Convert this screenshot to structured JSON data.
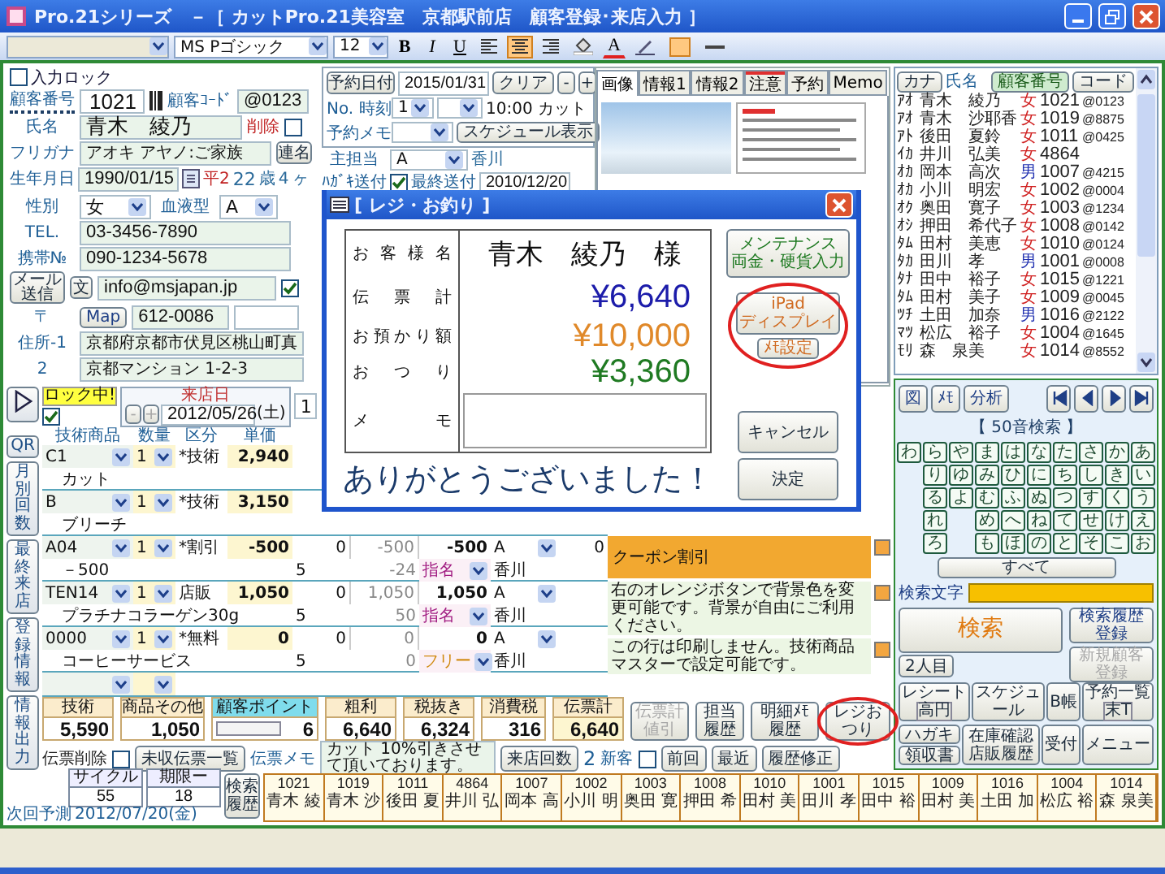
{
  "window": {
    "title": "Pro.21シリーズ　－［ カットPro.21美容室　京都駅前店　顧客登録･来店入力 ］"
  },
  "toolbar": {
    "font": "MS Pゴシック",
    "size": "12",
    "format_buttons": [
      "B",
      "I",
      "U"
    ],
    "align": [
      {
        "selected": false
      },
      {
        "selected": true
      },
      {
        "selected": false
      }
    ],
    "font_color_label": "A"
  },
  "customer": {
    "input_lock": {
      "label": "入力ロック",
      "checked": false
    },
    "number_label": "顧客番号",
    "number": "1021",
    "code_label": "顧客ｺｰﾄﾞ",
    "code": "@0123",
    "name_label": "氏名",
    "name": "青木　綾乃",
    "delete_label": "削除",
    "delete_checked": false,
    "kana_label": "フリガナ",
    "kana": "アオキ アヤノ:ご家族",
    "joint_button": "連名",
    "birth_label": "生年月日",
    "birth": "1990/01/15",
    "era": "平2",
    "age": "22",
    "age_unit": "歳",
    "months": "4",
    "months_unit": "ヶ",
    "sex_label": "性別",
    "sex": "女",
    "blood_label": "血液型",
    "blood": "A",
    "tel_label": "TEL.",
    "tel": "03-3456-7890",
    "mobile_label": "携帯№",
    "mobile": "090-1234-5678",
    "mail_button": "メール送信",
    "text_button": "文",
    "email": "info@msjapan.jp",
    "mail_checked": true,
    "zip_label": "〒",
    "map_button": "Map",
    "zip": "612-0086",
    "address1_label": "住所-1",
    "address1": "京都府京都市伏見区桃山町真",
    "address2_label": "2",
    "address2": "京都マンション 1-2-3"
  },
  "reservation": {
    "date_button": "予約日付",
    "date": "2015/01/31",
    "clear_button": "クリア",
    "step_buttons": [
      "-",
      "+"
    ],
    "no_label": "No. 時刻",
    "no": "1",
    "memo_label": "予約メモ",
    "memo": "10:00 カット",
    "schedule_button": "スケジュール表示",
    "staff_label": "主担当",
    "staff": "A",
    "staff_name": "香川",
    "postcard_label": "ﾊｶﾞｷ送付",
    "postcard_checked": true,
    "last_sent_label": "最終送付",
    "last_sent": "2010/12/20"
  },
  "tabs": [
    {
      "label": "画像",
      "selected": true,
      "alert": false
    },
    {
      "label": "情報1",
      "selected": false,
      "alert": false
    },
    {
      "label": "情報2",
      "selected": false,
      "alert": false
    },
    {
      "label": "注意",
      "selected": false,
      "alert": true
    },
    {
      "label": "予約",
      "selected": false,
      "alert": false
    },
    {
      "label": "Memo",
      "selected": false,
      "alert": false
    }
  ],
  "customer_list": {
    "kana_button": "カナ",
    "name_header": "氏名",
    "number_button": "顧客番号",
    "code_button": "コード",
    "rows": [
      {
        "kana": "ｱｵ",
        "name": "青木　綾乃",
        "sex": "女",
        "kind": "female",
        "number": "1021",
        "code": "@0123"
      },
      {
        "kana": "ｱｵ",
        "name": "青木　沙耶香",
        "sex": "女",
        "kind": "female",
        "number": "1019",
        "code": "@8875"
      },
      {
        "kana": "ｱﾄ",
        "name": "後田　夏鈴",
        "sex": "女",
        "kind": "female",
        "number": "1011",
        "code": "@0425"
      },
      {
        "kana": "ｲｶ",
        "name": "井川　弘美",
        "sex": "女",
        "kind": "female",
        "number": "4864"
      },
      {
        "kana": "ｵｶ",
        "name": "岡本　高次",
        "sex": "男",
        "kind": "male",
        "number": "1007",
        "code": "@4215"
      },
      {
        "kana": "ｵｶ",
        "name": "小川　明宏",
        "sex": "女",
        "kind": "female",
        "number": "1002",
        "code": "@0004"
      },
      {
        "kana": "ｵｸ",
        "name": "奥田　寛子",
        "sex": "女",
        "kind": "female",
        "number": "1003",
        "code": "@1234"
      },
      {
        "kana": "ｵｼ",
        "name": "押田　希代子",
        "sex": "女",
        "kind": "female",
        "number": "1008",
        "code": "@0142"
      },
      {
        "kana": "ﾀﾑ",
        "name": "田村　美恵",
        "sex": "女",
        "kind": "female",
        "number": "1010",
        "code": "@0124"
      },
      {
        "kana": "ﾀｶ",
        "name": "田川　孝",
        "sex": "男",
        "kind": "male",
        "number": "1001",
        "code": "@0008"
      },
      {
        "kana": "ﾀﾅ",
        "name": "田中　裕子",
        "sex": "女",
        "kind": "female",
        "number": "1015",
        "code": "@1221"
      },
      {
        "kana": "ﾀﾑ",
        "name": "田村　美子",
        "sex": "女",
        "kind": "female",
        "number": "1009",
        "code": "@0045"
      },
      {
        "kana": "ﾂﾁ",
        "name": "土田　加奈",
        "sex": "男",
        "kind": "male",
        "number": "1016",
        "code": "@2122"
      },
      {
        "kana": "ﾏﾂ",
        "name": "松広　裕子",
        "sex": "女",
        "kind": "female",
        "number": "1004",
        "code": "@1645"
      },
      {
        "kana": "ﾓﾘ",
        "name": "森　泉美",
        "sex": "女",
        "kind": "female",
        "number": "1014",
        "code": "@8552"
      }
    ]
  },
  "side_buttons": [
    "QR",
    "月別回数",
    "最終来店",
    "登録情報",
    "情報出力"
  ],
  "visit": {
    "lock_label": "ロック中!",
    "lock_checked": true,
    "date_label": "来店日",
    "step_buttons": [
      "-",
      "+"
    ],
    "date": "2012/05/26",
    "weekday": "(土)",
    "count": "1"
  },
  "items": {
    "columns": [
      "技術商品",
      "数量",
      "区分",
      "単価"
    ],
    "rows": [
      {
        "kind": "item",
        "code": "C1",
        "qty": "1",
        "category": "*技術",
        "price": "2,940",
        "name": "カット"
      },
      {
        "kind": "item",
        "code": "B",
        "qty": "1",
        "category": "*技術",
        "price": "3,150",
        "name": "ブリーチ"
      },
      {
        "kind": "item",
        "code": "A04",
        "qty": "1",
        "category": "*割引",
        "price": "-500",
        "column_5": "0",
        "column_6": "-500",
        "column_7": "-500",
        "column_8": "A",
        "column_9": "0",
        "name": "－500",
        "sub_5": "5",
        "sub_6": "-24",
        "nomination": {
          "label": "指名",
          "color": "#a01a80"
        },
        "staff": "香川"
      },
      {
        "kind": "item",
        "code": "TEN14",
        "qty": "1",
        "category": "店販",
        "price": "1,050",
        "column_5": "0",
        "column_6": "1,050",
        "column_7": "1,050",
        "column_8": "A",
        "name": "プラチナコラーゲン30g",
        "sub_5": "5",
        "sub_6": "50",
        "nomination": {
          "label": "指名",
          "color": "#a01a80"
        },
        "staff": "香川"
      },
      {
        "kind": "item",
        "code": "0000",
        "qty": "1",
        "category": "*無料",
        "price": "0",
        "column_5": "0",
        "column_6": "0",
        "column_7": "0",
        "column_8": "A",
        "name": "コーヒーサービス",
        "sub_5": "5",
        "sub_6": "0",
        "nomination": {
          "label": "フリー",
          "color": "#d08a10"
        },
        "staff": "香川"
      },
      {
        "kind": "blank"
      }
    ]
  },
  "notes": [
    {
      "kind": "tag",
      "text": "クーポン割引"
    },
    {
      "kind": "text",
      "text": "右のオレンジボタンで背景色を変更可能です。背景が自由にご利用ください。"
    },
    {
      "kind": "text",
      "text": "この行は印刷しません。技術商品マスターで設定可能です。"
    }
  ],
  "totals": [
    {
      "label": "技術",
      "value": "5,590",
      "kind": "plain"
    },
    {
      "label": "商品その他",
      "value": "1,050",
      "kind": "plain"
    },
    {
      "label": "顧客ポイント",
      "value": "6",
      "kind": "points"
    },
    {
      "label": "粗利",
      "value": "6,640",
      "kind": "plain"
    },
    {
      "label": "税抜き",
      "value": "6,324",
      "kind": "plain"
    },
    {
      "label": "消費税",
      "value": "316",
      "kind": "plain"
    },
    {
      "label": "伝票計",
      "value": "6,640",
      "kind": "plain"
    }
  ],
  "total_buttons": [
    {
      "label": "伝票計値引",
      "disabled": true,
      "circled": false
    },
    {
      "label": "担当履歴",
      "disabled": false,
      "circled": false
    },
    {
      "label": "明細ﾒﾓ履歴",
      "disabled": false,
      "circled": false
    },
    {
      "label": "レジおつり",
      "disabled": false,
      "circled": true
    }
  ],
  "slip": {
    "delete_label": "伝票削除",
    "delete_checked": false,
    "unpaid_button": "未収伝票一覧",
    "memo_label": "伝票メモ",
    "memo": "カット 10%引きさせて頂いております。",
    "visits_button": "来店回数",
    "visits": "2",
    "new_label": "新客",
    "new_checked": false,
    "buttons": [
      "前回",
      "最近",
      "履歴修正"
    ]
  },
  "forecast": {
    "label": "次回予測",
    "date": "2012/07/20(金)",
    "cycle_label": "サイクル",
    "cycle": "55",
    "limit_label": "期限ー",
    "limit": "18",
    "history_button": "検索履歴"
  },
  "recent": [
    {
      "number": "1021",
      "name": "青木 綾"
    },
    {
      "number": "1019",
      "name": "青木 沙"
    },
    {
      "number": "1011",
      "name": "後田 夏"
    },
    {
      "number": "4864",
      "name": "井川 弘"
    },
    {
      "number": "1007",
      "name": "岡本 高"
    },
    {
      "number": "1002",
      "name": "小川 明"
    },
    {
      "number": "1003",
      "name": "奥田 寛"
    },
    {
      "number": "1008",
      "name": "押田 希"
    },
    {
      "number": "1010",
      "name": "田村 美"
    },
    {
      "number": "1001",
      "name": "田川 孝"
    },
    {
      "number": "1015",
      "name": "田中 裕"
    },
    {
      "number": "1009",
      "name": "田村 美"
    },
    {
      "number": "1016",
      "name": "土田 加"
    },
    {
      "number": "1004",
      "name": "松広 裕"
    },
    {
      "number": "1014",
      "name": "森 泉美"
    }
  ],
  "search": {
    "tool_buttons": [
      "図",
      "ﾒﾓ",
      "分析"
    ],
    "title": "【 50音検索 】",
    "kana_rows": [
      [
        "わ",
        "ら",
        "や",
        "ま",
        "は",
        "な",
        "た",
        "さ",
        "か",
        "あ"
      ],
      [
        null,
        "り",
        "ゆ",
        "み",
        "ひ",
        "に",
        "ち",
        "し",
        "き",
        "い"
      ],
      [
        null,
        "る",
        "よ",
        "む",
        "ふ",
        "ぬ",
        "つ",
        "す",
        "く",
        "う"
      ],
      [
        null,
        "れ",
        null,
        "め",
        "へ",
        "ね",
        "て",
        "せ",
        "け",
        "え"
      ],
      [
        null,
        "ろ",
        null,
        "も",
        "ほ",
        "の",
        "と",
        "そ",
        "こ",
        "お"
      ]
    ],
    "all_button": "すべて",
    "query_label": "検索文字",
    "search_button": "検索",
    "second_button": "2人目",
    "history_button": "検索履歴登録",
    "new_button": {
      "label": "新規顧客登録",
      "disabled": true
    },
    "menu_buttons": [
      {
        "label": "レシート",
        "badge": "高円"
      },
      {
        "label": "スケジュール"
      },
      {
        "label": "B帳"
      },
      {
        "label": "予約一覧",
        "badge": "末T"
      }
    ],
    "menu_buttons_2": [
      {
        "label": "ハガキ"
      },
      {
        "label": "領収書"
      },
      {
        "label": "在庫確認店販履歴"
      },
      {
        "label": "受付"
      },
      {
        "label": "メニュー"
      }
    ]
  },
  "dialog": {
    "title": "[ レジ・お釣り ]",
    "rows": [
      {
        "label": "お客様名",
        "value": "青木　綾乃　様",
        "kind": "name"
      },
      {
        "label": "伝票計",
        "value": "¥6,640",
        "kind": "amount",
        "color": "#1c1caa"
      },
      {
        "label": "お預かり額",
        "value": "¥10,000",
        "kind": "amount",
        "color": "#e0892a"
      },
      {
        "label": "おつり",
        "value": "¥3,360",
        "kind": "amount",
        "color": "#1f7a22"
      },
      {
        "label": "メモ",
        "kind": "memo"
      }
    ],
    "maintenance_button": {
      "label": "メンテナンス",
      "sub": "両金・硬貨入力"
    },
    "tools": {
      "circled": true,
      "display_button": {
        "label": "iPad",
        "sub": "ディスプレイ"
      },
      "memo_button": "ﾒﾓ設定"
    },
    "cancel_button": "キャンセル",
    "ok_button": "決定",
    "thanks": "ありがとうございました！"
  }
}
